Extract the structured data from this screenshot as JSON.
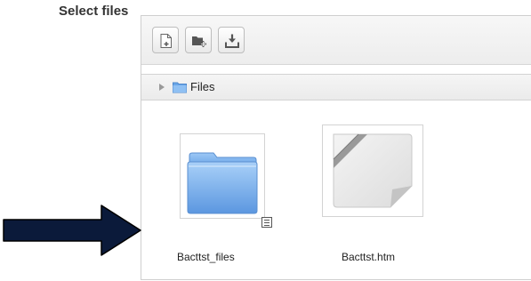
{
  "form": {
    "select_files_label": "Select files"
  },
  "toolbar": {
    "buttons": [
      {
        "name": "add-file",
        "icon": "add-file-icon"
      },
      {
        "name": "create-folder",
        "icon": "new-folder-icon"
      },
      {
        "name": "download",
        "icon": "download-icon"
      }
    ]
  },
  "path": {
    "root_label": "Files"
  },
  "files": [
    {
      "name": "Bacttst_files",
      "type": "folder",
      "icon": "folder-icon"
    },
    {
      "name": "Bacttst.htm",
      "type": "file",
      "icon": "document-icon"
    }
  ],
  "colors": {
    "folder_blue": "#7fb1ee",
    "arrow": "#0b1a3a"
  }
}
